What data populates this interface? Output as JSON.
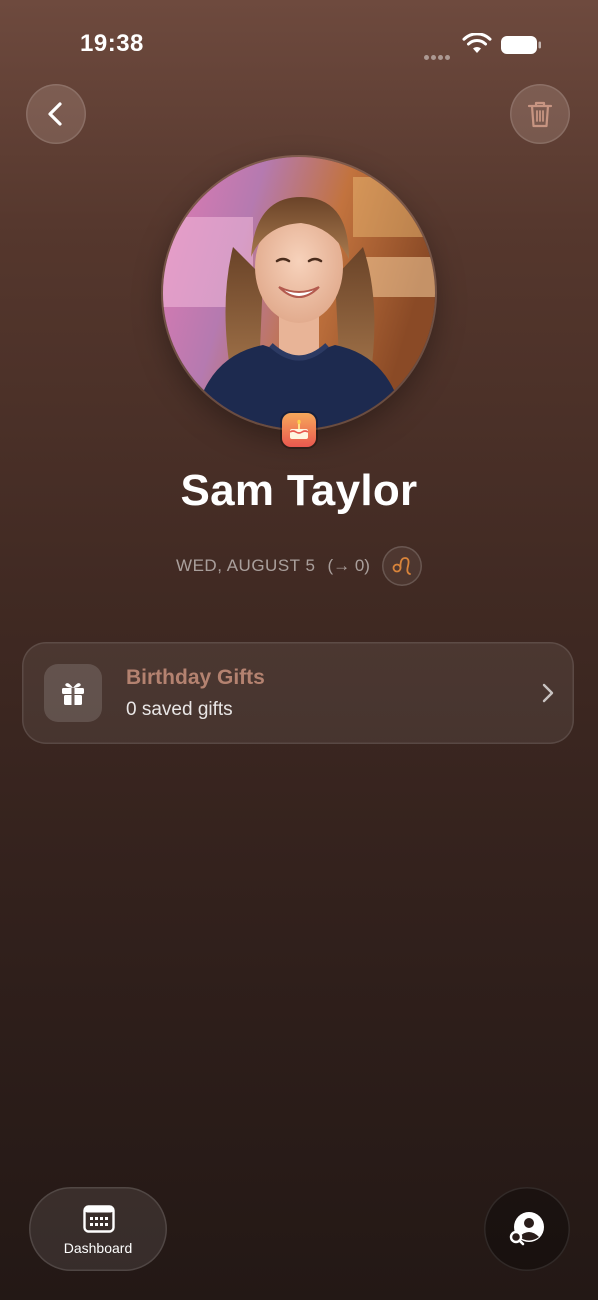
{
  "status_bar": {
    "time": "19:38",
    "icons": [
      "signal-dots-icon",
      "wifi-icon",
      "battery-icon"
    ]
  },
  "header": {
    "back_icon": "chevron-left-icon",
    "delete_icon": "trash-icon"
  },
  "profile": {
    "name": "Sam Taylor",
    "birthday_date": "WED, AUGUST 5",
    "days_until": "(→ 0)",
    "zodiac_icon": "leo-zodiac-icon",
    "badge_icon": "birthday-cake-icon"
  },
  "gifts_card": {
    "title": "Birthday Gifts",
    "subtitle": "0 saved gifts",
    "icon": "gift-icon"
  },
  "bottom_bar": {
    "dashboard_label": "Dashboard",
    "dashboard_icon": "calendar-grid-icon",
    "search_icon": "contact-search-icon"
  },
  "colors": {
    "background_top": "#6e4a3e",
    "background_bottom": "#231815",
    "gifts_title": "#b48270",
    "zodiac_accent": "#d9843a"
  }
}
